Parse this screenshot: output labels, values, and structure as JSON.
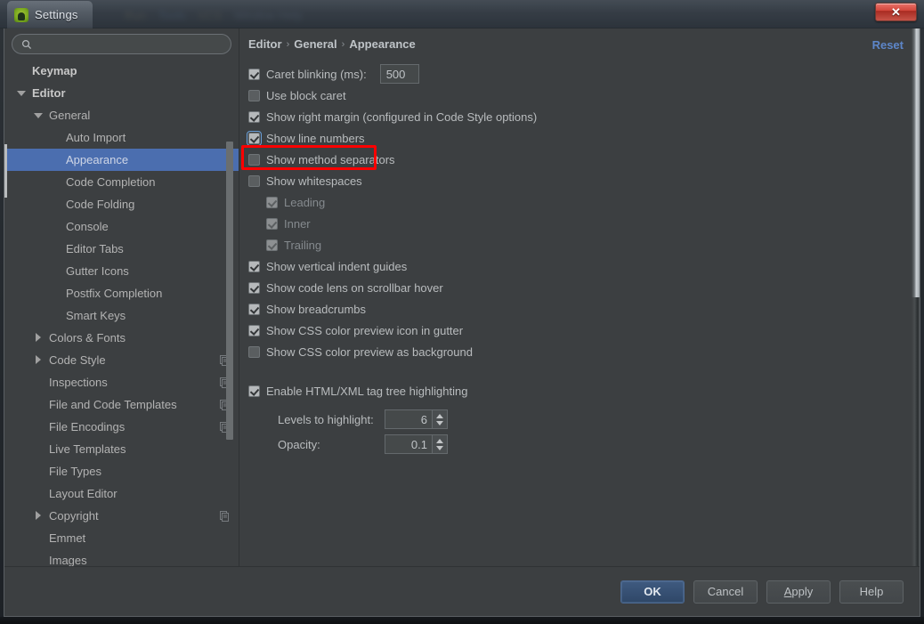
{
  "window": {
    "title": "Settings",
    "app_icon": "android-studio-icon",
    "close_label": "✕"
  },
  "backdrop_hints": [
    "Run",
    "Tools",
    "VCS",
    "Window",
    "Help"
  ],
  "search": {
    "placeholder": "",
    "value": "",
    "icon": "search-icon"
  },
  "sidebar": {
    "scroll_position": "middle",
    "items": [
      {
        "label": "Keymap",
        "level": 0,
        "arrow": "none",
        "bold": true,
        "badge": false,
        "selected": false
      },
      {
        "label": "Editor",
        "level": 0,
        "arrow": "down",
        "bold": true,
        "badge": false,
        "selected": false
      },
      {
        "label": "General",
        "level": 1,
        "arrow": "down",
        "bold": false,
        "badge": false,
        "selected": false
      },
      {
        "label": "Auto Import",
        "level": 2,
        "arrow": "none",
        "bold": false,
        "badge": false,
        "selected": false
      },
      {
        "label": "Appearance",
        "level": 2,
        "arrow": "none",
        "bold": false,
        "badge": false,
        "selected": true
      },
      {
        "label": "Code Completion",
        "level": 2,
        "arrow": "none",
        "bold": false,
        "badge": false,
        "selected": false
      },
      {
        "label": "Code Folding",
        "level": 2,
        "arrow": "none",
        "bold": false,
        "badge": false,
        "selected": false
      },
      {
        "label": "Console",
        "level": 2,
        "arrow": "none",
        "bold": false,
        "badge": false,
        "selected": false
      },
      {
        "label": "Editor Tabs",
        "level": 2,
        "arrow": "none",
        "bold": false,
        "badge": false,
        "selected": false
      },
      {
        "label": "Gutter Icons",
        "level": 2,
        "arrow": "none",
        "bold": false,
        "badge": false,
        "selected": false
      },
      {
        "label": "Postfix Completion",
        "level": 2,
        "arrow": "none",
        "bold": false,
        "badge": false,
        "selected": false
      },
      {
        "label": "Smart Keys",
        "level": 2,
        "arrow": "none",
        "bold": false,
        "badge": false,
        "selected": false
      },
      {
        "label": "Colors & Fonts",
        "level": 1,
        "arrow": "right",
        "bold": false,
        "badge": false,
        "selected": false
      },
      {
        "label": "Code Style",
        "level": 1,
        "arrow": "right",
        "bold": false,
        "badge": true,
        "selected": false
      },
      {
        "label": "Inspections",
        "level": 1,
        "arrow": "none",
        "bold": false,
        "badge": true,
        "selected": false
      },
      {
        "label": "File and Code Templates",
        "level": 1,
        "arrow": "none",
        "bold": false,
        "badge": true,
        "selected": false
      },
      {
        "label": "File Encodings",
        "level": 1,
        "arrow": "none",
        "bold": false,
        "badge": true,
        "selected": false
      },
      {
        "label": "Live Templates",
        "level": 1,
        "arrow": "none",
        "bold": false,
        "badge": false,
        "selected": false
      },
      {
        "label": "File Types",
        "level": 1,
        "arrow": "none",
        "bold": false,
        "badge": false,
        "selected": false
      },
      {
        "label": "Layout Editor",
        "level": 1,
        "arrow": "none",
        "bold": false,
        "badge": false,
        "selected": false
      },
      {
        "label": "Copyright",
        "level": 1,
        "arrow": "right",
        "bold": false,
        "badge": true,
        "selected": false
      },
      {
        "label": "Emmet",
        "level": 1,
        "arrow": "none",
        "bold": false,
        "badge": false,
        "selected": false
      },
      {
        "label": "Images",
        "level": 1,
        "arrow": "none",
        "bold": false,
        "badge": false,
        "selected": false
      }
    ]
  },
  "main": {
    "breadcrumb": [
      "Editor",
      "General",
      "Appearance"
    ],
    "breadcrumb_separator": "›",
    "reset_label": "Reset",
    "caret_blinking": {
      "label": "Caret blinking (ms):",
      "checked": true,
      "value": "500"
    },
    "options": [
      {
        "label": "Use block caret",
        "checked": false,
        "indent": false,
        "disabled": false,
        "highlighted": false
      },
      {
        "label": "Show right margin (configured in Code Style options)",
        "checked": true,
        "indent": false,
        "disabled": false,
        "highlighted": false
      },
      {
        "label": "Show line numbers",
        "checked": true,
        "indent": false,
        "disabled": false,
        "highlighted": true
      },
      {
        "label": "Show method separators",
        "checked": false,
        "indent": false,
        "disabled": false,
        "highlighted": false
      },
      {
        "label": "Show whitespaces",
        "checked": false,
        "indent": false,
        "disabled": false,
        "highlighted": false
      },
      {
        "label": "Leading",
        "checked": true,
        "indent": true,
        "disabled": true,
        "highlighted": false
      },
      {
        "label": "Inner",
        "checked": true,
        "indent": true,
        "disabled": true,
        "highlighted": false
      },
      {
        "label": "Trailing",
        "checked": true,
        "indent": true,
        "disabled": true,
        "highlighted": false
      },
      {
        "label": "Show vertical indent guides",
        "checked": true,
        "indent": false,
        "disabled": false,
        "highlighted": false
      },
      {
        "label": "Show code lens on scrollbar hover",
        "checked": true,
        "indent": false,
        "disabled": false,
        "highlighted": false
      },
      {
        "label": "Show breadcrumbs",
        "checked": true,
        "indent": false,
        "disabled": false,
        "highlighted": false
      },
      {
        "label": "Show CSS color preview icon in gutter",
        "checked": true,
        "indent": false,
        "disabled": false,
        "highlighted": false
      },
      {
        "label": "Show CSS color preview as background",
        "checked": false,
        "indent": false,
        "disabled": false,
        "highlighted": false
      }
    ],
    "html_highlighting": {
      "label": "Enable HTML/XML tag tree highlighting",
      "checked": true
    },
    "spinners": [
      {
        "label": "Levels to highlight:",
        "value": "6"
      },
      {
        "label": "Opacity:",
        "value": "0.1"
      }
    ]
  },
  "footer": {
    "ok": "OK",
    "cancel": "Cancel",
    "apply_prefix": "A",
    "apply_rest": "pply",
    "help": "Help"
  },
  "colors": {
    "accent_selection": "#4b6eaf",
    "link": "#5d86c9",
    "panel_bg": "#3c3f41",
    "annotation": "#ff0000"
  }
}
